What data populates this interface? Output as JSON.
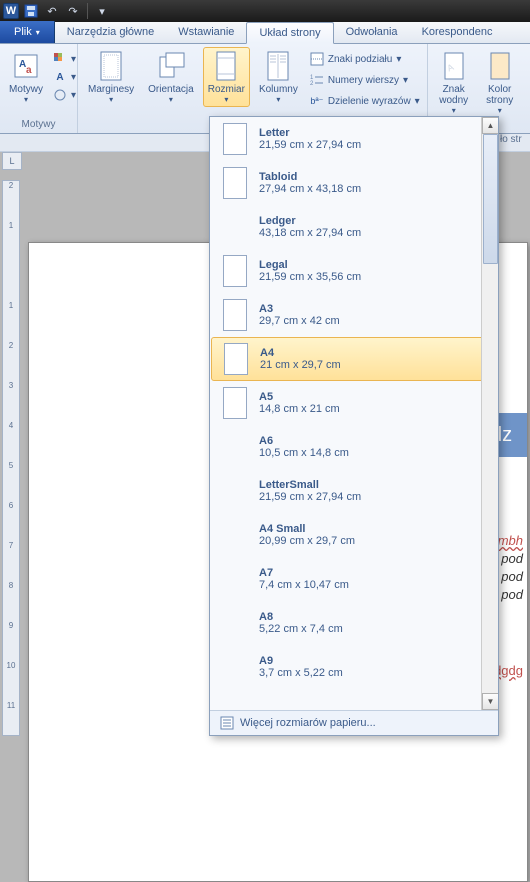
{
  "qat": {
    "undo_tip": "↶",
    "redo_tip": "↷"
  },
  "tabs": {
    "file": "Plik",
    "items": [
      "Narzędzia główne",
      "Wstawianie",
      "Układ strony",
      "Odwołania",
      "Korespondenc"
    ],
    "active_index": 2
  },
  "ribbon": {
    "themes": {
      "btn": "Motywy",
      "group": "Motywy"
    },
    "page_setup": {
      "margins": "Marginesy",
      "orientation": "Orientacja",
      "size": "Rozmiar",
      "columns": "Kolumny",
      "breaks": "Znaki podziału",
      "line_numbers": "Numery wierszy",
      "hyphenation": "Dzielenie wyrazów"
    },
    "background": {
      "watermark": "Znak\nwodny",
      "page_color": "Kolor\nstrony"
    }
  },
  "subtab_right": "ło str",
  "sizes": [
    {
      "name": "Letter",
      "dims": "21,59 cm x 27,94 cm",
      "thumb": true
    },
    {
      "name": "Tabloid",
      "dims": "27,94 cm x 43,18 cm",
      "thumb": true
    },
    {
      "name": "Ledger",
      "dims": "43,18 cm x 27,94 cm",
      "thumb": false
    },
    {
      "name": "Legal",
      "dims": "21,59 cm x 35,56 cm",
      "thumb": true
    },
    {
      "name": "A3",
      "dims": "29,7 cm x 42 cm",
      "thumb": true
    },
    {
      "name": "A4",
      "dims": "21 cm x 29,7 cm",
      "thumb": true,
      "selected": true
    },
    {
      "name": "A5",
      "dims": "14,8 cm x 21 cm",
      "thumb": true
    },
    {
      "name": "A6",
      "dims": "10,5 cm x 14,8 cm",
      "thumb": false
    },
    {
      "name": "LetterSmall",
      "dims": "21,59 cm x 27,94 cm",
      "thumb": false
    },
    {
      "name": "A4 Small",
      "dims": "20,99 cm x 29,7 cm",
      "thumb": false
    },
    {
      "name": "A7",
      "dims": "7,4 cm x 10,47 cm",
      "thumb": false
    },
    {
      "name": "A8",
      "dims": "5,22 cm x 7,4 cm",
      "thumb": false
    },
    {
      "name": "A9",
      "dims": "3,7 cm x 5,22 cm",
      "thumb": false
    }
  ],
  "more_sizes": "Więcej rozmiarów papieru...",
  "ruler_marks": [
    "2",
    "1",
    "",
    "1",
    "2",
    "3",
    "4",
    "5",
    "6",
    "7",
    "8",
    "9",
    "10",
    "11"
  ],
  "page_fragments": [
    "dz",
    "mbh",
    "pod",
    "pod",
    "pod",
    "dgdg"
  ],
  "ruler_corner": "L"
}
